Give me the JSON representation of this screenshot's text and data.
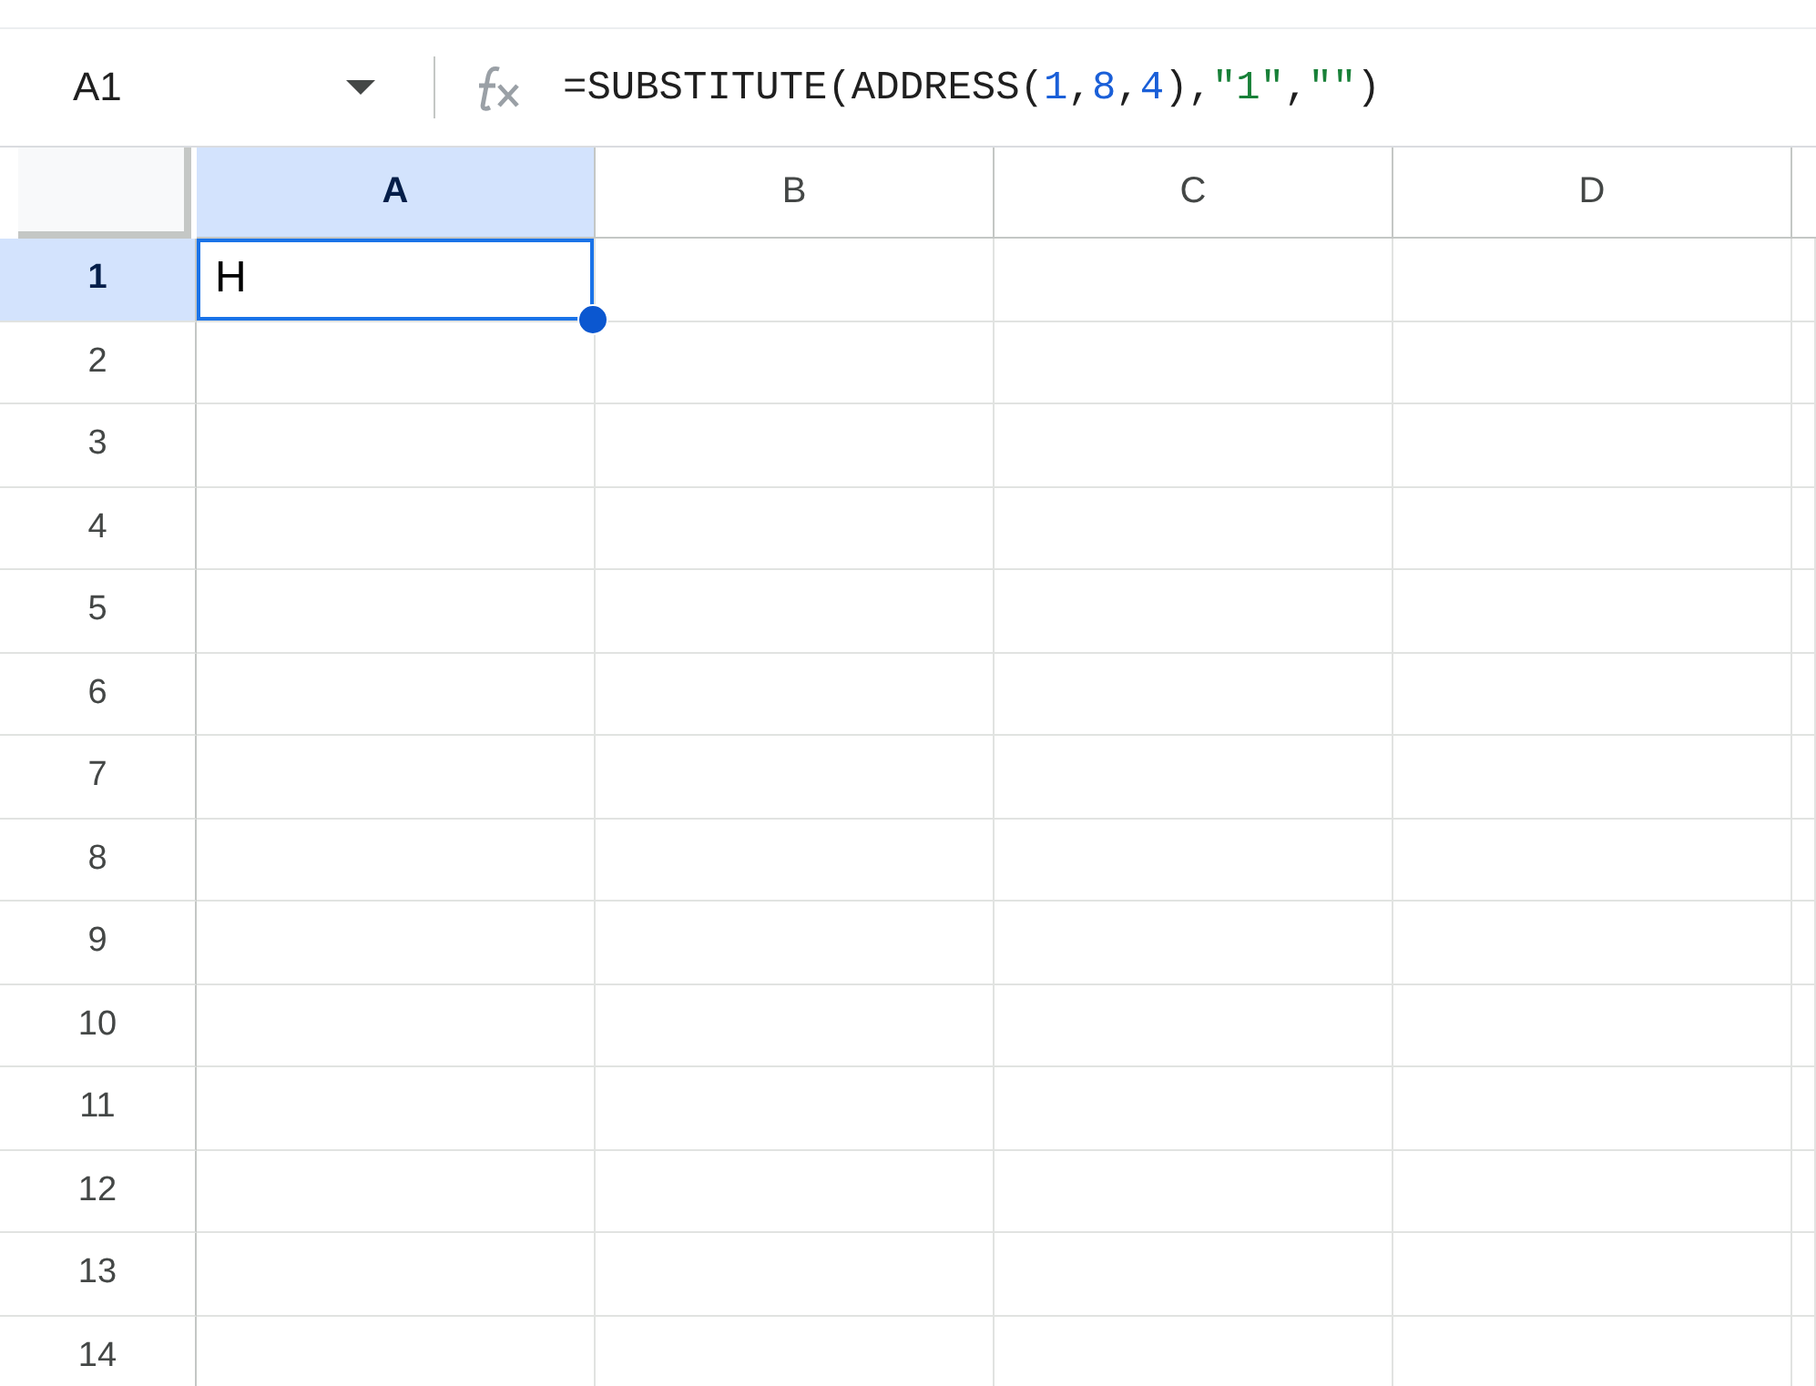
{
  "name_box": {
    "value": "A1"
  },
  "formula_bar": {
    "tokens": [
      {
        "text": "=SUBSTITUTE(ADDRESS(",
        "kind": "plain"
      },
      {
        "text": "1",
        "kind": "number"
      },
      {
        "text": ",",
        "kind": "plain"
      },
      {
        "text": "8",
        "kind": "number"
      },
      {
        "text": ",",
        "kind": "plain"
      },
      {
        "text": "4",
        "kind": "number"
      },
      {
        "text": "),",
        "kind": "plain"
      },
      {
        "text": "\"1\"",
        "kind": "string"
      },
      {
        "text": ",",
        "kind": "plain"
      },
      {
        "text": "\"\"",
        "kind": "string"
      },
      {
        "text": ")",
        "kind": "plain"
      }
    ]
  },
  "grid": {
    "columns": [
      {
        "label": "A",
        "selected": true
      },
      {
        "label": "B",
        "selected": false
      },
      {
        "label": "C",
        "selected": false
      },
      {
        "label": "D",
        "selected": false
      }
    ],
    "rows": [
      {
        "label": "1",
        "selected": true,
        "cells": [
          {
            "value": "H",
            "selected": true
          }
        ]
      },
      {
        "label": "2",
        "selected": false
      },
      {
        "label": "3",
        "selected": false
      },
      {
        "label": "4",
        "selected": false
      },
      {
        "label": "5",
        "selected": false
      },
      {
        "label": "6",
        "selected": false
      },
      {
        "label": "7",
        "selected": false
      },
      {
        "label": "8",
        "selected": false
      },
      {
        "label": "9",
        "selected": false
      },
      {
        "label": "10",
        "selected": false
      },
      {
        "label": "11",
        "selected": false
      },
      {
        "label": "12",
        "selected": false
      },
      {
        "label": "13",
        "selected": false
      },
      {
        "label": "14",
        "selected": false
      }
    ]
  }
}
